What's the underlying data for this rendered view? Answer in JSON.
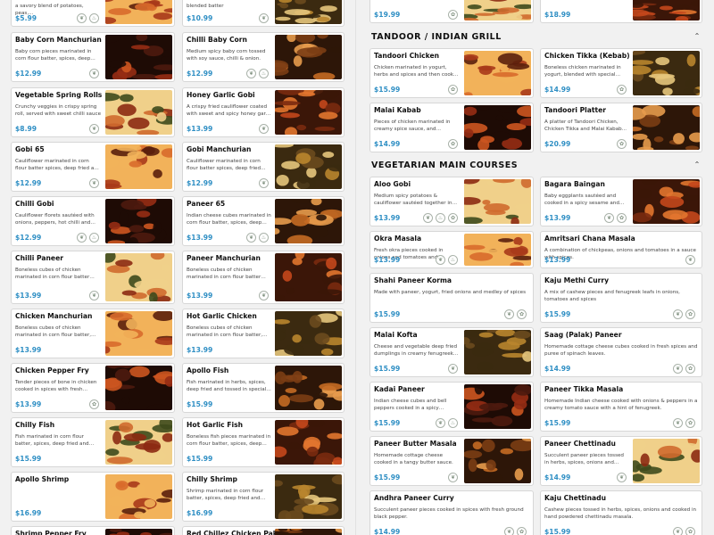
{
  "left_column": [
    {
      "name": "",
      "desc": "a savory blend of potatoes, peas,...",
      "price": "$5.99",
      "icons": [
        "leaf",
        "chili"
      ]
    },
    {
      "name": "",
      "desc": "blended batter",
      "price": "$10.99",
      "icons": [
        "leaf"
      ]
    },
    {
      "name": "Baby Corn Manchurian",
      "desc": "Baby corn pieces marinated in corn flour batter, spices, deep fried and...",
      "price": "$12.99",
      "icons": [
        "leaf"
      ]
    },
    {
      "name": "Chilli Baby Corn",
      "desc": "Medium spicy baby corn tossed with soy sauce, chilli & onion.",
      "price": "$12.99",
      "icons": [
        "leaf",
        "chili"
      ]
    },
    {
      "name": "Vegetable Spring Rolls",
      "desc": "Crunchy veggies in crispy spring roll, served with sweet chilli sauce",
      "price": "$8.99",
      "icons": [
        "leaf"
      ]
    },
    {
      "name": "Honey Garlic Gobi",
      "desc": "A crispy fried cauliflower coated with sweet and spicy honey garlic sauce.",
      "price": "$13.99",
      "icons": [
        "leaf"
      ]
    },
    {
      "name": "Gobi 65",
      "desc": "Cauliflower marinated in corn flour batter spices, deep fried and tosse...",
      "price": "$12.99",
      "icons": [
        "leaf"
      ]
    },
    {
      "name": "Gobi Manchurian",
      "desc": "Cauliflower marinated in corn flour batter spices, deep fried and tosse...",
      "price": "$12.99",
      "icons": [
        "leaf"
      ]
    },
    {
      "name": "Chilli Gobi",
      "desc": "Cauliflower florets sautéed with onions, peppers, hot chilli and soy...",
      "price": "$12.99",
      "icons": [
        "leaf",
        "chili"
      ]
    },
    {
      "name": "Paneer 65",
      "desc": "Indian cheese cubes marinated in corn flour batter, spices, deep fried...",
      "price": "$13.99",
      "icons": [
        "leaf",
        "chili"
      ]
    },
    {
      "name": "Chilli Paneer",
      "desc": "Boneless cubes of chicken marinated in corn flour batter spices, deep fri...",
      "price": "$13.99",
      "icons": [
        "leaf"
      ]
    },
    {
      "name": "Paneer Manchurian",
      "desc": "Boneless cubes of chicken marinated in corn flour batter spices, deep fri...",
      "price": "$13.99",
      "icons": [
        "leaf"
      ]
    },
    {
      "name": "Chicken Manchurian",
      "desc": "Boneless cubes of chicken marinated in corn flour batter, spices, deep...",
      "price": "$13.99",
      "icons": []
    },
    {
      "name": "Hot Garlic Chicken",
      "desc": "Boneless cubes of chicken marinated in corn flour batter, spices, deep...",
      "price": "$13.99",
      "icons": []
    },
    {
      "name": "Chicken Pepper Fry",
      "desc": "Tender pieces of bone in chicken cooked in spices with fresh ground...",
      "price": "$13.99",
      "icons": [
        "nut"
      ]
    },
    {
      "name": "Apollo Fish",
      "desc": "Fish marinated in herbs, spices, deep fried and tossed in special spice...",
      "price": "$15.99",
      "icons": []
    },
    {
      "name": "Chilly Fish",
      "desc": "Fish marinated in corn flour batter, spices, deep fried and tossed with...",
      "price": "$15.99",
      "icons": []
    },
    {
      "name": "Hot Garlic Fish",
      "desc": "Boneless fish pieces marinated in corn flour batter, spices, deep fried...",
      "price": "$15.99",
      "icons": []
    },
    {
      "name": "Apollo Shrimp",
      "desc": "",
      "price": "$16.99",
      "icons": []
    },
    {
      "name": "Chilly Shrimp",
      "desc": "Shrimp marinated in corn flour batter, spices, deep fried and tosse...",
      "price": "$16.99",
      "icons": []
    },
    {
      "name": "Shrimp Pepper Fry",
      "desc": "",
      "price": "",
      "icons": []
    },
    {
      "name": "Red Chillez Chicken Pakora",
      "desc": "",
      "price": "",
      "icons": []
    }
  ],
  "top_right": [
    {
      "name": "",
      "desc": "",
      "price": "$19.99",
      "icons": [
        "nut"
      ]
    },
    {
      "name": "",
      "desc": "",
      "price": "$18.99",
      "icons": []
    }
  ],
  "sections": [
    {
      "title": "TANDOOR / INDIAN GRILL",
      "items": [
        {
          "name": "Tandoori Chicken",
          "desc": "Chicken marinated in yogurt, herbs and spices and then cooked in a...",
          "price": "$15.99",
          "icons": [
            "nut"
          ]
        },
        {
          "name": "Chicken Tikka (Kebab)",
          "desc": "Boneless chicken marinated in yogurt, blended with special spices...",
          "price": "$14.99",
          "icons": [
            "nut"
          ]
        },
        {
          "name": "Malai Kabab",
          "desc": "Pieces of chicken marinated in creamy spice sauce, and barbeque...",
          "price": "$14.99",
          "icons": [
            "nut"
          ]
        },
        {
          "name": "Tandoori Platter",
          "desc": "A platter of Tandoori Chicken, Chicken Tikka and Malai Kabab...",
          "price": "$20.99",
          "icons": [
            "nut"
          ]
        }
      ]
    },
    {
      "title": "VEGETARIAN MAIN COURSES",
      "items": [
        {
          "name": "Aloo Gobi",
          "desc": "Medium spicy potatoes & cauliflower sautéed together in Onion sauce &...",
          "price": "$13.99",
          "icons": [
            "leaf",
            "chili",
            "nut"
          ]
        },
        {
          "name": "Bagara Baingan",
          "desc": "Baby eggplants sautéed and cooked in a spicy sesame and peanut sauce.",
          "price": "$13.99",
          "icons": [
            "leaf",
            "nut"
          ]
        },
        {
          "name": "Okra Masala",
          "desc": "Fresh okra pieces cooked in onions and tomatoes and garnished with...",
          "price": "$13.99",
          "icons": [
            "leaf",
            "chili"
          ]
        },
        {
          "name": "Amritsari Chana Masala",
          "desc": "A combination of chickpeas, onions and tomatoes in a sauce with spices.",
          "price": "$13.99",
          "icons": [
            "leaf"
          ]
        },
        {
          "name": "Shahi Paneer Korma",
          "desc": "Made with paneer, yogurt, fried onions and medley of spices",
          "price": "$15.99",
          "icons": [
            "leaf",
            "nut"
          ]
        },
        {
          "name": "Kaju Methi Curry",
          "desc": "A mix of cashew pieces and fenugreek leafs in onions, tomatoes and spices",
          "price": "$15.99",
          "icons": [
            "leaf",
            "nut"
          ]
        },
        {
          "name": "Malai Kofta",
          "desc": "Cheese and vegetable deep fried dumplings in creamy fenugreek...",
          "price": "$15.99",
          "icons": [
            "leaf"
          ]
        },
        {
          "name": "Saag (Palak) Paneer",
          "desc": "Homemade cottage cheese cubes cooked in fresh spices and puree of spinach leaves.",
          "price": "$14.99",
          "icons": [
            "leaf",
            "nut"
          ]
        },
        {
          "name": "Kadai Paneer",
          "desc": "Indian cheese cubes and bell peppers cooked in a spicy tomato...",
          "price": "$15.99",
          "icons": [
            "leaf",
            "chili"
          ]
        },
        {
          "name": "Paneer Tikka Masala",
          "desc": "Homemade Indian cheese cooked with onions & peppers in a creamy tomato sauce with a hint of fenugreek.",
          "price": "$15.99",
          "icons": [
            "leaf",
            "nut"
          ]
        },
        {
          "name": "Paneer Butter Masala",
          "desc": "Homemade cottage cheese cooked in a tangy butter sauce.",
          "price": "$15.99",
          "icons": [
            "leaf"
          ]
        },
        {
          "name": "Paneer Chettinadu",
          "desc": "Succulent paneer pieces tossed in herbs, spices, onions and cooked i...",
          "price": "$14.99",
          "icons": [
            "leaf"
          ]
        },
        {
          "name": "Andhra Paneer Curry",
          "desc": "Succulent paneer pieces cooked in spices with fresh ground black pepper.",
          "price": "$14.99",
          "icons": [
            "leaf",
            "nut"
          ]
        },
        {
          "name": "Kaju Chettinadu",
          "desc": "Cashew pieces tossed in herbs, spices, onions and cooked in hand powdered chettinadu masala.",
          "price": "$15.99",
          "icons": [
            "leaf",
            "nut"
          ]
        }
      ]
    }
  ],
  "icon_glyphs": {
    "leaf": "❦",
    "chili": "♨",
    "nut": "✿"
  },
  "colors": {
    "price": "#2f8fc4",
    "card_border": "#d7d7d7",
    "background": "#f1f1f1"
  }
}
